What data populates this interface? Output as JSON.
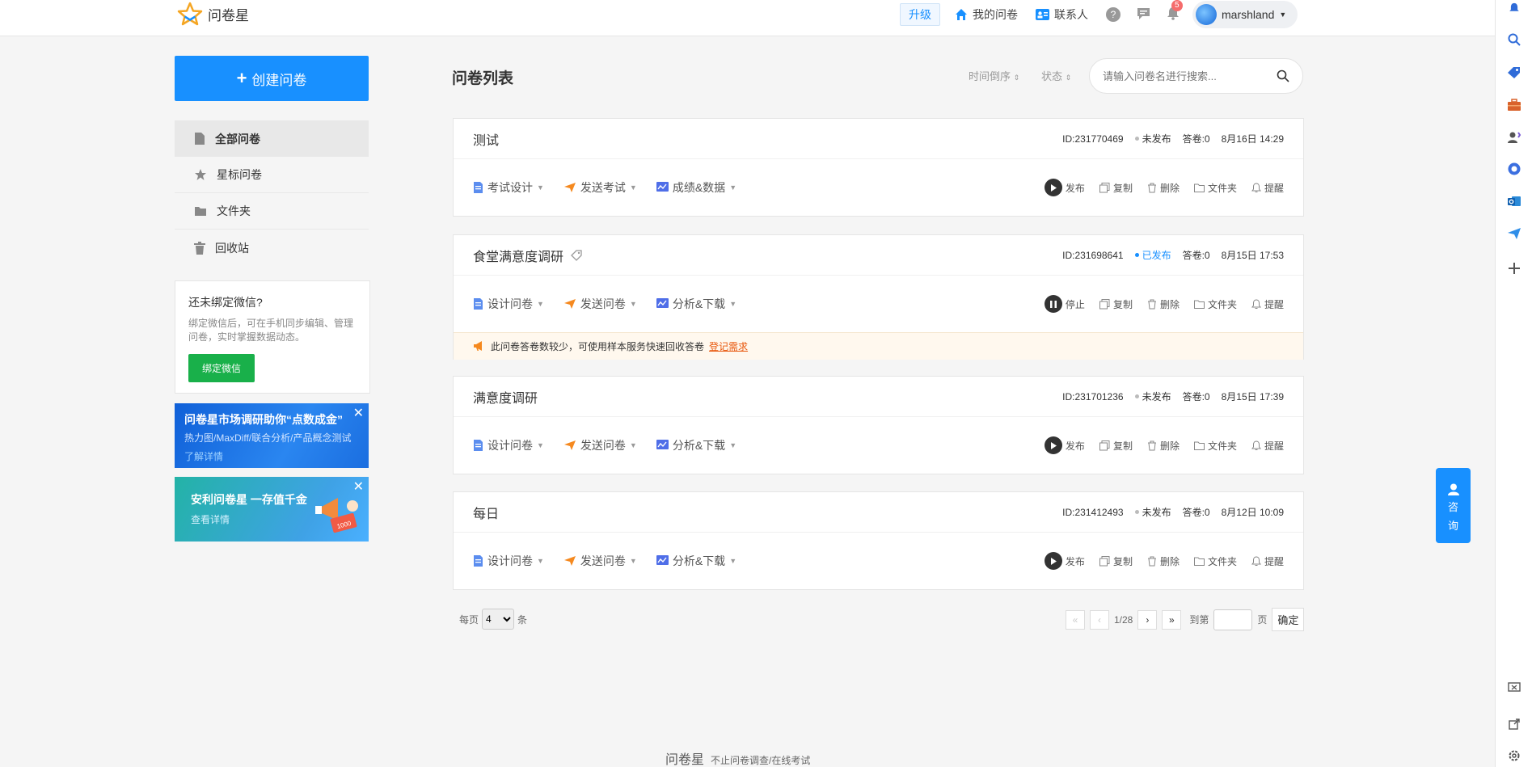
{
  "header": {
    "logo_text": "问卷星",
    "upgrade": "升级",
    "my_surveys": "我的问卷",
    "contacts": "联系人",
    "help": "?",
    "notif_count": "5",
    "username": "marshland"
  },
  "sidebar": {
    "create": "创建问卷",
    "items": [
      {
        "label": "全部问卷"
      },
      {
        "label": "星标问卷"
      },
      {
        "label": "文件夹"
      },
      {
        "label": "回收站"
      }
    ],
    "wechat": {
      "title": "还未绑定微信?",
      "desc": "绑定微信后，可在手机同步编辑、管理问卷，实时掌握数据动态。",
      "button": "绑定微信"
    },
    "banner1": {
      "title": "问卷星市场调研助你“点数成金”",
      "sub": "热力图/MaxDiff/联合分析/产品概念测试",
      "link": "了解详情"
    },
    "banner2": {
      "title": "安利问卷星  一存值千金",
      "link": "查看详情",
      "coupon": "1000"
    }
  },
  "main": {
    "title": "问卷列表",
    "sort_time": "时间倒序",
    "sort_status": "状态",
    "search_placeholder": "请输入问卷名进行搜索...",
    "surveys": [
      {
        "title": "测试",
        "id": "ID:231770469",
        "status": "未发布",
        "answers": "答卷:0",
        "date": "8月16日 14:29",
        "a1": "考试设计",
        "a2": "发送考试",
        "a3": "成绩&数据",
        "run": "发布"
      },
      {
        "title": "食堂满意度调研",
        "id": "ID:231698641",
        "status": "已发布",
        "answers": "答卷:0",
        "date": "8月15日 17:53",
        "a1": "设计问卷",
        "a2": "发送问卷",
        "a3": "分析&下载",
        "run": "停止",
        "tip": "此问卷答卷数较少，可使用样本服务快速回收答卷",
        "tip_link": "登记需求"
      },
      {
        "title": "满意度调研",
        "id": "ID:231701236",
        "status": "未发布",
        "answers": "答卷:0",
        "date": "8月15日 17:39",
        "a1": "设计问卷",
        "a2": "发送问卷",
        "a3": "分析&下载",
        "run": "发布"
      },
      {
        "title": "每日",
        "id": "ID:231412493",
        "status": "未发布",
        "answers": "答卷:0",
        "date": "8月12日 10:09",
        "a1": "设计问卷",
        "a2": "发送问卷",
        "a3": "分析&下载",
        "run": "发布"
      }
    ],
    "common_actions": {
      "copy": "复制",
      "delete": "删除",
      "folder": "文件夹",
      "remind": "提醒"
    }
  },
  "pagination": {
    "per_page_label": "每页",
    "per_page_value": "4",
    "per_page_unit": "条",
    "page_info": "1/28",
    "goto_label": "到第",
    "page_unit": "页",
    "confirm": "确定"
  },
  "footer": {
    "logo": "问卷星",
    "slogan": "不止问卷调查/在线考试"
  },
  "consult": {
    "line1": "咨",
    "line2": "询"
  },
  "colors": {
    "primary": "#1890ff",
    "wechat": "#19b04a",
    "warn_link": "#e8570c"
  }
}
